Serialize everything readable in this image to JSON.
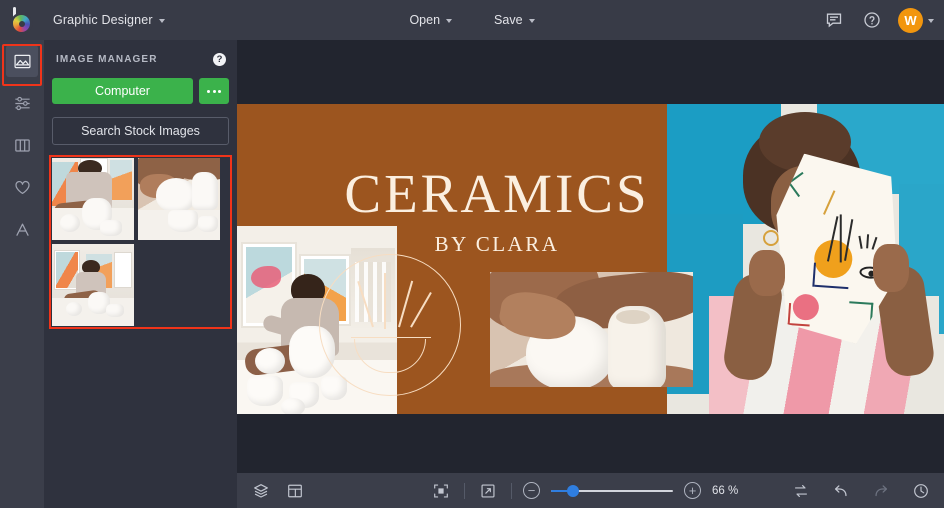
{
  "app": {
    "logo_name": "befunky-logo",
    "document_title": "Graphic Designer"
  },
  "topbar": {
    "open_label": "Open",
    "save_label": "Save",
    "feedback_icon": "chat-icon",
    "help_icon": "help-circle-icon",
    "avatar_initial": "W"
  },
  "rail": {
    "items": [
      {
        "icon": "image-icon",
        "name": "image-manager",
        "active": true
      },
      {
        "icon": "sliders-icon",
        "name": "edit-tools",
        "active": false
      },
      {
        "icon": "columns-icon",
        "name": "templates",
        "active": false
      },
      {
        "icon": "heart-icon",
        "name": "graphics",
        "active": false
      },
      {
        "icon": "text-icon",
        "name": "text-tool",
        "active": false
      }
    ]
  },
  "panel": {
    "title": "IMAGE MANAGER",
    "help_icon": "help-circle-icon",
    "computer_label": "Computer",
    "more_icon": "more-dots-icon",
    "search_stock_label": "Search Stock Images",
    "thumbnails": [
      {
        "name": "thumbnail-ceramics-studio-1"
      },
      {
        "name": "thumbnail-hands-shaping-vessel"
      },
      {
        "name": "thumbnail-ceramics-studio-2"
      }
    ]
  },
  "canvas": {
    "design_title": "CERAMICS",
    "design_subtitle": "BY CLARA",
    "brand_color": "#9c551f",
    "title_color": "#fbefe0",
    "photos": [
      {
        "name": "canvas-photo-left-studio"
      },
      {
        "name": "canvas-photo-center-vessels"
      },
      {
        "name": "canvas-photo-right-portrait"
      }
    ],
    "circle_graphic": "bowl-line-art-icon"
  },
  "bottombar": {
    "layers_icon": "layers-icon",
    "layout_icon": "layout-grid-icon",
    "fit_icon": "fit-to-screen-icon",
    "expand_icon": "expand-icon",
    "zoom_out_label": "−",
    "zoom_in_label": "+",
    "zoom_value": "66 %",
    "zoom_percent": 66,
    "slider_position_pct": 18,
    "swap_icon": "swap-icon",
    "undo_icon": "undo-icon",
    "redo_icon": "redo-icon",
    "history_icon": "history-clock-icon",
    "accent_color": "#2f7ee0"
  }
}
